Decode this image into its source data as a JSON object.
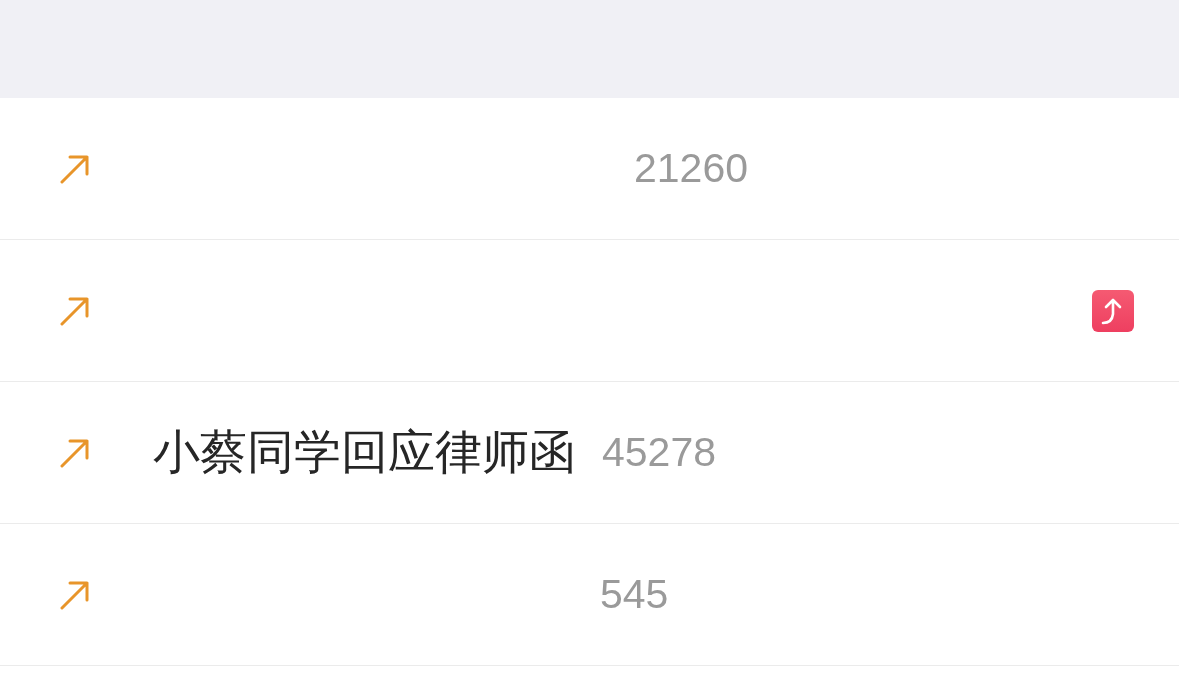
{
  "rows": [
    {
      "count": "21260",
      "badge": false
    },
    {
      "badge": true
    },
    {
      "title": "小蔡同学回应律师函",
      "count": "45278",
      "badge": false
    },
    {
      "count": "545",
      "badge": false
    }
  ]
}
